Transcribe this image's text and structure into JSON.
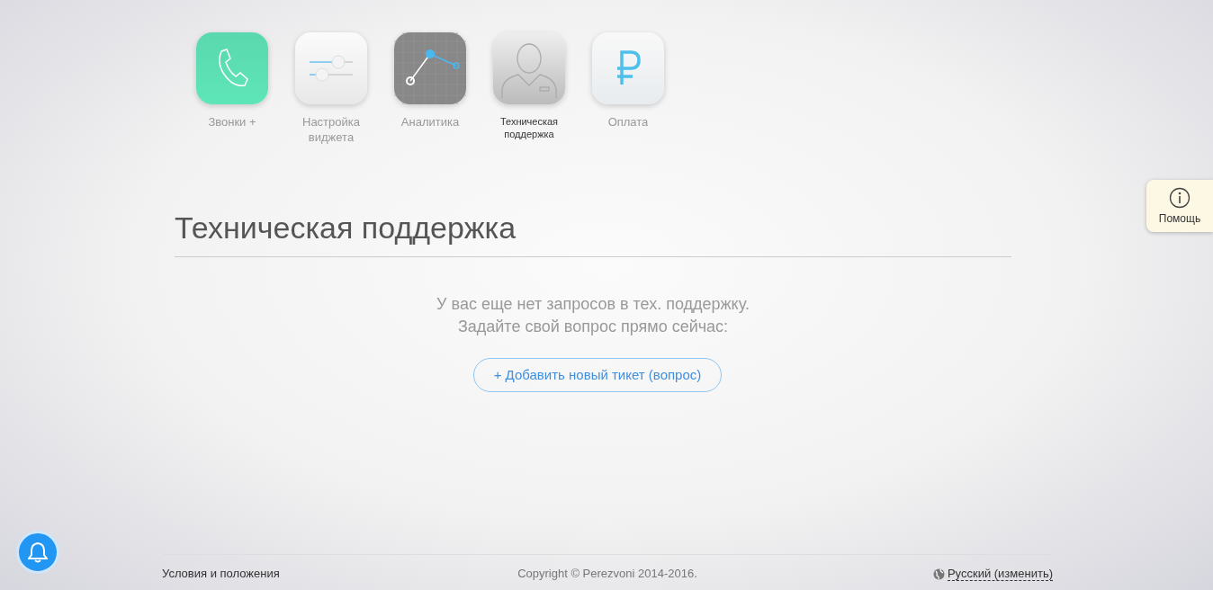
{
  "nav": [
    {
      "kind": "calls",
      "label": "Звонки +",
      "selected": false
    },
    {
      "kind": "widget",
      "label": "Настройка виджета",
      "selected": false
    },
    {
      "kind": "analytics",
      "label": "Аналитика",
      "selected": false
    },
    {
      "kind": "support",
      "label": "Техническая поддержка",
      "selected": true
    },
    {
      "kind": "payment",
      "label": "Оплата",
      "selected": false
    }
  ],
  "page_title": "Техническая поддержка",
  "empty_message": [
    "У вас еще нет запросов в тех. поддержку.",
    "Задайте свой вопрос прямо сейчас:"
  ],
  "add_button": "+ Добавить новый тикет (вопрос)",
  "help_tab": "Помощь",
  "footer": {
    "left": "Условия и положения",
    "center": "Copyright © Perezvoni 2014-2016.",
    "language": "Русский (изменить)"
  }
}
